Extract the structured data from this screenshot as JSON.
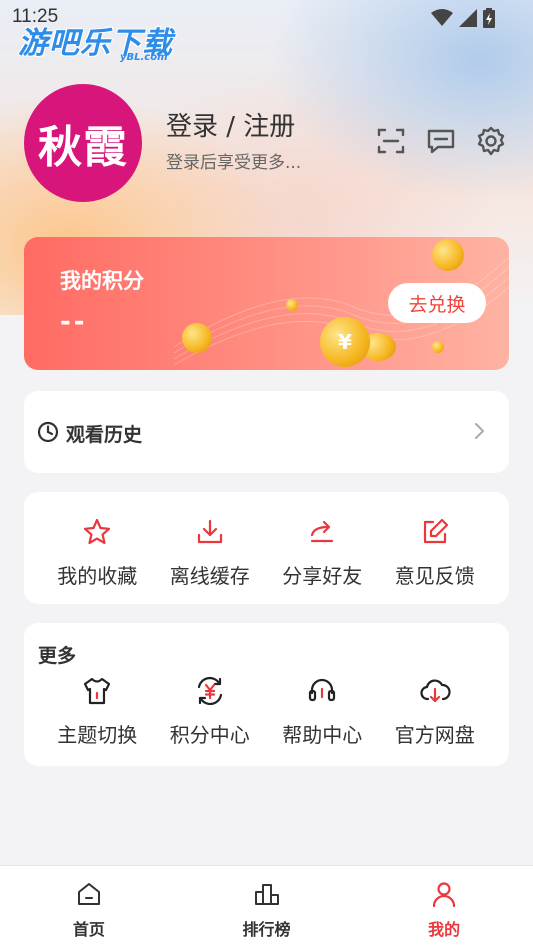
{
  "status_bar": {
    "time": "11:25"
  },
  "watermark": {
    "text": "游吧乐下载",
    "sub": "yBL.com"
  },
  "profile": {
    "avatar_text": "秋霞",
    "login_title": "登录 / 注册",
    "login_subtitle": "登录后享受更多..."
  },
  "header_icons": [
    "scan-icon",
    "message-icon",
    "settings-icon"
  ],
  "points": {
    "title": "我的积分",
    "value": "--",
    "button": "去兑换"
  },
  "history": {
    "label": "观看历史"
  },
  "actions": [
    {
      "label": "我的收藏",
      "icon": "star-icon"
    },
    {
      "label": "离线缓存",
      "icon": "download-icon"
    },
    {
      "label": "分享好友",
      "icon": "share-icon"
    },
    {
      "label": "意见反馈",
      "icon": "edit-icon"
    }
  ],
  "more": {
    "title": "更多",
    "items": [
      {
        "label": "主题切换",
        "icon": "shirt-icon"
      },
      {
        "label": "积分中心",
        "icon": "yuan-exchange-icon"
      },
      {
        "label": "帮助中心",
        "icon": "headset-icon"
      },
      {
        "label": "官方网盘",
        "icon": "cloud-download-icon"
      }
    ]
  },
  "tabs": [
    {
      "label": "首页",
      "icon": "home-icon"
    },
    {
      "label": "排行榜",
      "icon": "ranking-icon"
    },
    {
      "label": "我的",
      "icon": "user-icon",
      "active": true
    }
  ],
  "colors": {
    "accent": "#e8383d",
    "avatar_bg": "#d7157a",
    "points_gradient_start": "#ff6b63"
  }
}
